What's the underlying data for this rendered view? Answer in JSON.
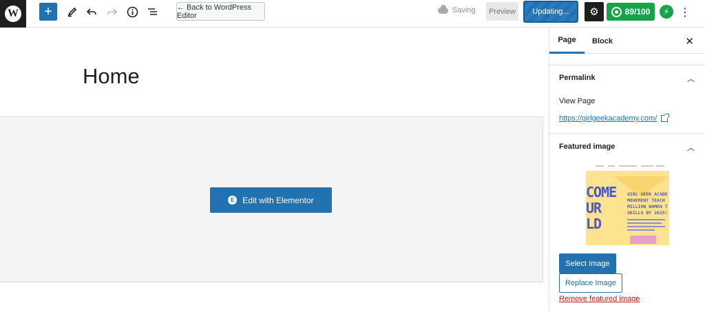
{
  "toolbar": {
    "add_icon": "+",
    "back_label": "← Back to WordPress Editor",
    "saving_label": "Saving",
    "preview_label": "Preview",
    "update_label": "Updating...",
    "score_label": "89/100",
    "jetpack_glyph": "⚡",
    "more_glyph": "⋮"
  },
  "editor": {
    "title": "Home",
    "elementor_button": "Edit with Elementor"
  },
  "sidebar": {
    "tabs": [
      "Page",
      "Block"
    ],
    "permalink": {
      "title": "Permalink",
      "view_page": "View Page",
      "url": "https://girlgeekacademy.com/"
    },
    "featured_image": {
      "title": "Featured image",
      "thumb_big_text": "COME\nUR\nLD",
      "thumb_small_text": "GIRL GEEK ACADE\nMOVEMENT TEACH\nMILLION WOMEN T\nSKILLS BY 2025!",
      "select_label": "Select Image",
      "replace_label": "Replace Image",
      "remove_label": "Remove featured image"
    }
  },
  "colors": {
    "primary": "#2271b1",
    "score_green": "#16a34a",
    "danger": "#cc1818"
  },
  "icons": [
    "wordpress-logo-icon",
    "plus-icon",
    "pencil-icon",
    "undo-icon",
    "redo-icon",
    "info-icon",
    "list-view-icon",
    "cloud-icon",
    "gear-icon",
    "score-icon",
    "jetpack-icon",
    "more-vertical-icon",
    "close-icon",
    "chevron-up-icon",
    "external-link-icon",
    "elementor-icon"
  ]
}
